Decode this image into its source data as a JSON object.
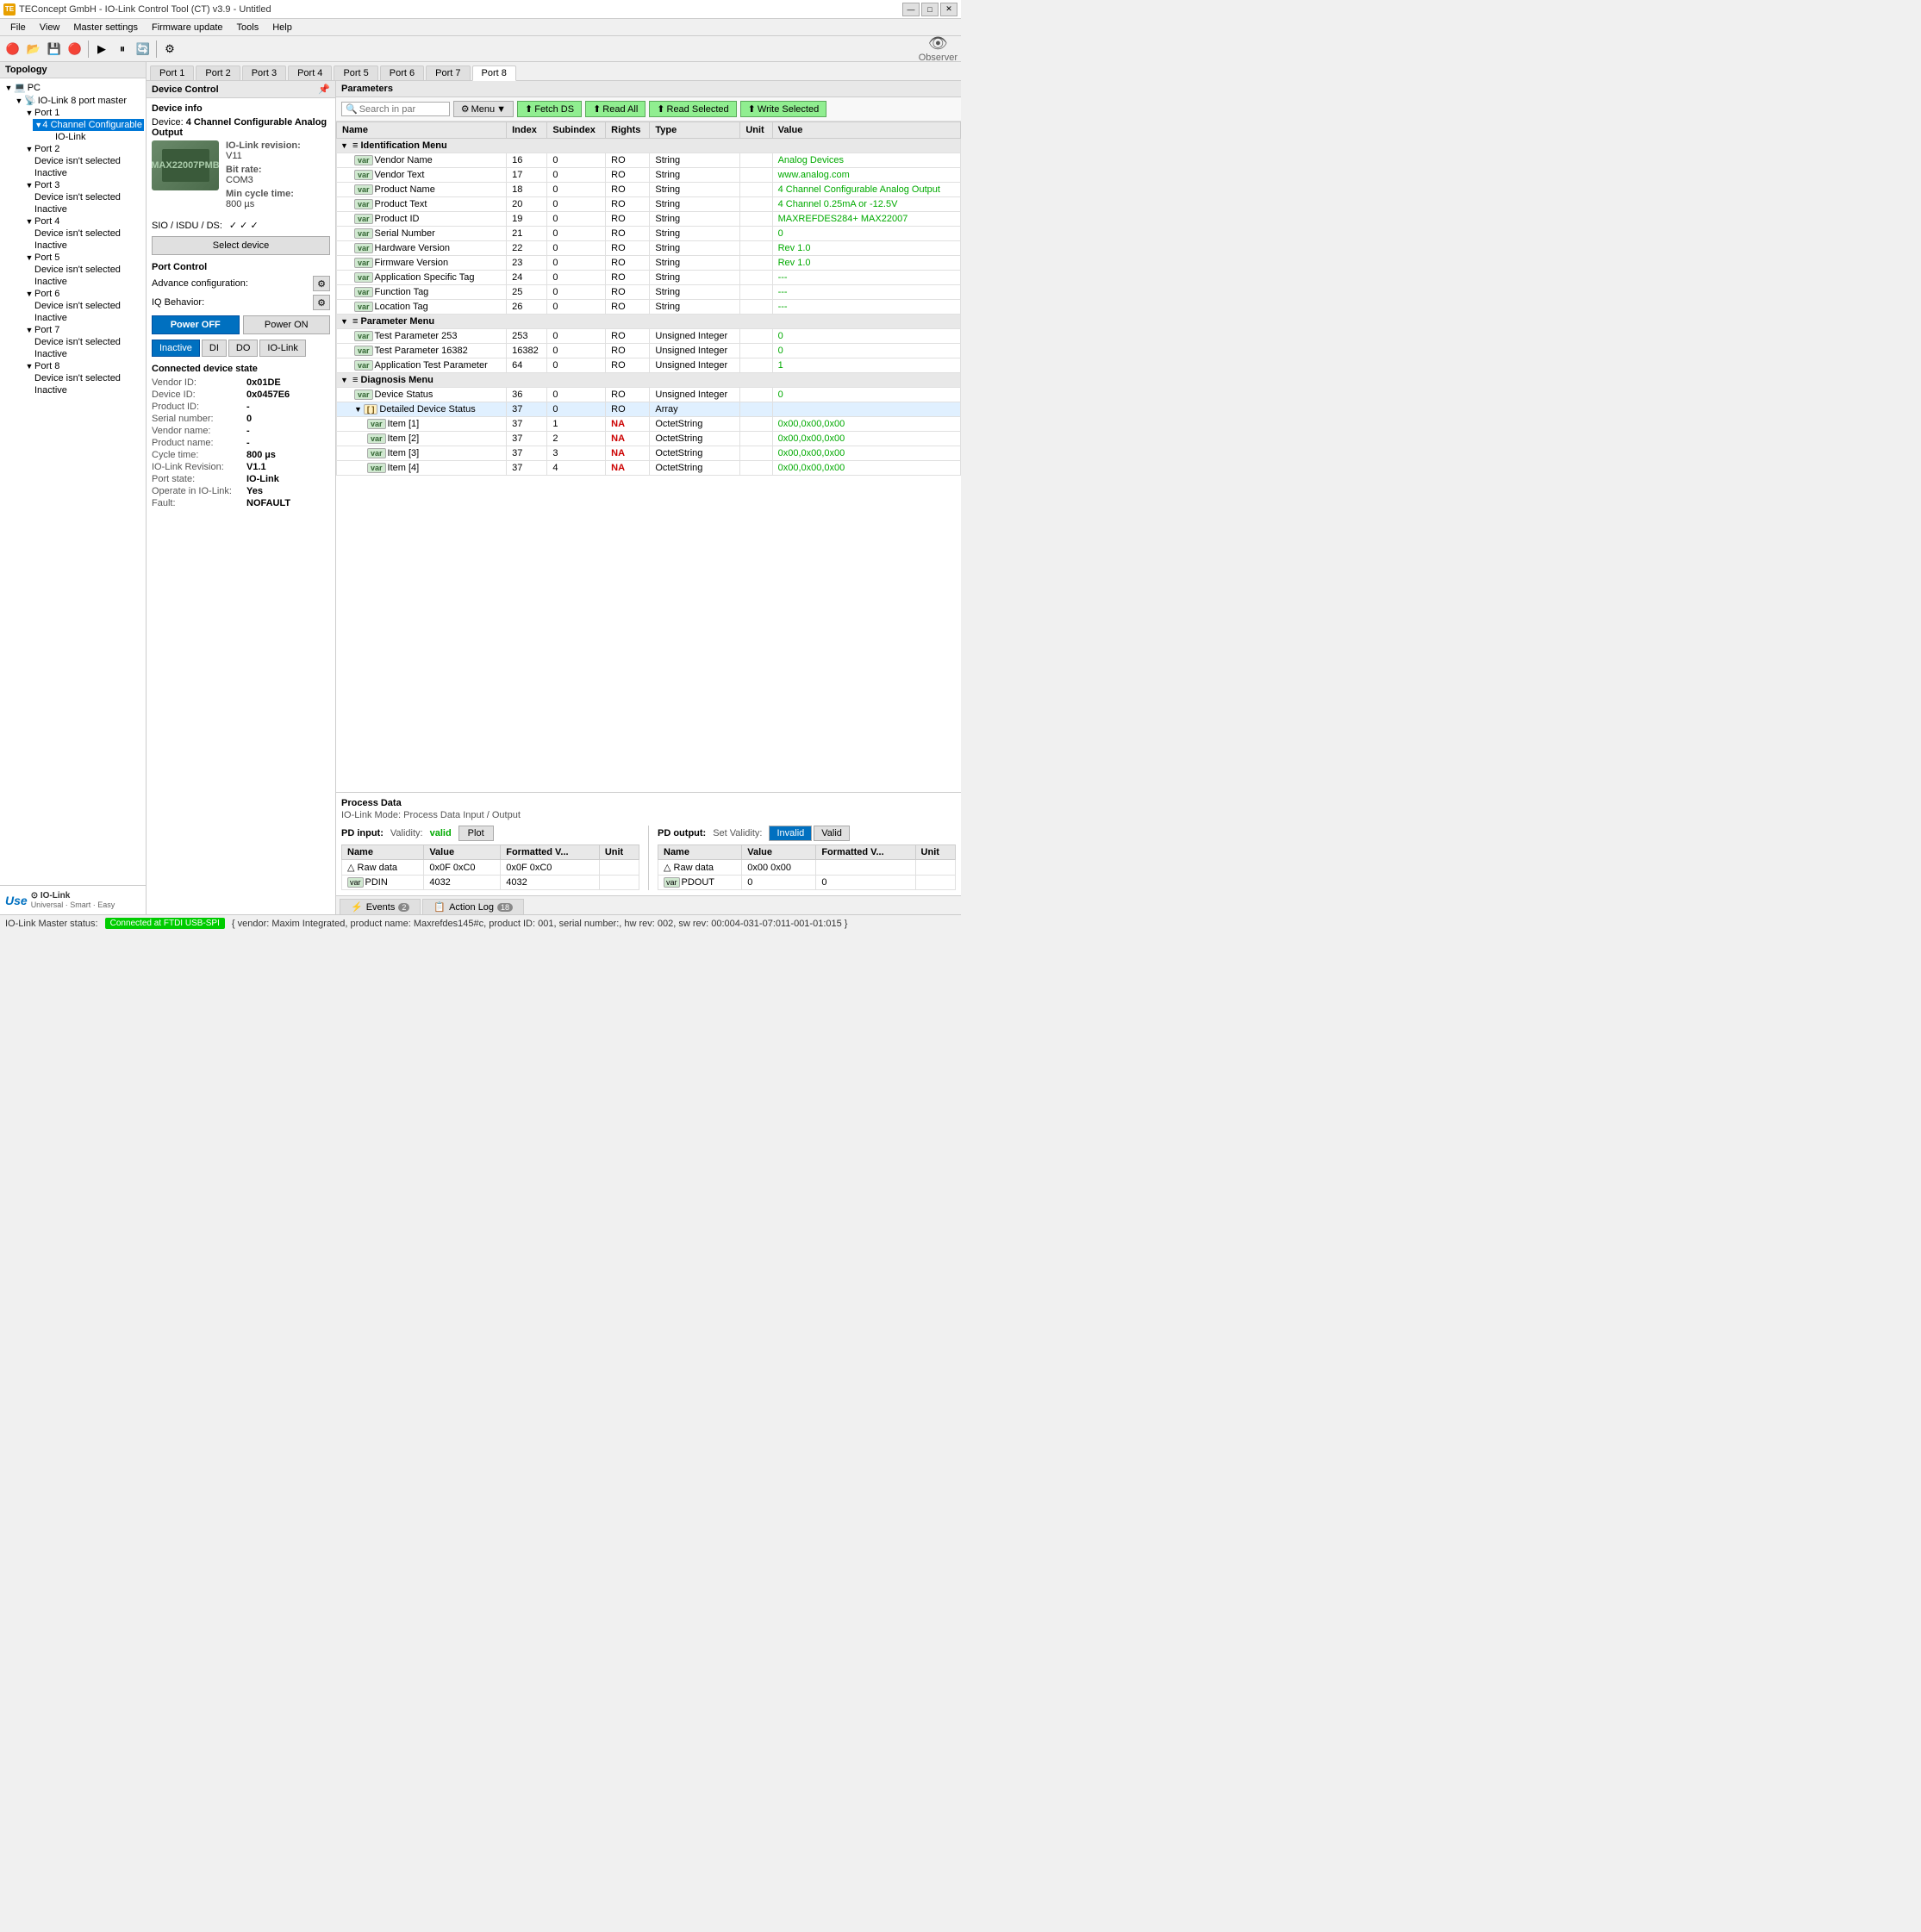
{
  "window": {
    "title": "TEConcept GmbH - IO-Link Control Tool (CT) v3.9 - Untitled",
    "icon": "TE"
  },
  "titlebar": {
    "controls": [
      "—",
      "□",
      "✕"
    ]
  },
  "menubar": {
    "items": [
      "File",
      "View",
      "Master settings",
      "Firmware update",
      "Tools",
      "Help"
    ]
  },
  "toolbar": {
    "observer_label": "Observer"
  },
  "topology": {
    "header": "Topology",
    "tree": {
      "pc": "PC",
      "master": "IO-Link 8 port master",
      "port1": "Port 1",
      "device1": "4 Channel Configurable",
      "iolink1": "IO-Link",
      "port2": "Port 2",
      "device2": "Device isn't selected",
      "inactive2": "Inactive",
      "port3": "Port 3",
      "device3": "Device isn't selected",
      "inactive3": "Inactive",
      "port4": "Port 4",
      "device4": "Device isn't selected",
      "inactive4": "Inactive",
      "port5": "Port 5",
      "device5": "Device isn't selected",
      "inactive5": "Inactive",
      "port6": "Port 6",
      "device6": "Device isn't selected",
      "inactive6": "Inactive",
      "port7": "Port 7",
      "device7": "Device isn't selected",
      "inactive7": "Inactive",
      "port8": "Port 8",
      "device8": "Device isn't selected",
      "inactive8": "Inactive"
    },
    "logo": {
      "use": "Use",
      "iolink": "⊙ IO-Link",
      "tagline": "Universal · Smart · Easy"
    }
  },
  "port_tabs": [
    "Port 1",
    "Port 2",
    "Port 3",
    "Port 4",
    "Port 5",
    "Port 6",
    "Port 7",
    "Port 8"
  ],
  "active_port": "Port 8",
  "device_control": {
    "header": "Device Control",
    "device_info_label": "Device info",
    "device_label": "Device:",
    "device_name": "4 Channel Configurable Analog Output",
    "device_image_label": "Device Image",
    "chip_label": "MAX22007PMB",
    "revision_label": "IO-Link revision:",
    "revision_val": "V11",
    "bitrate_label": "Bit rate:",
    "bitrate_val": "COM3",
    "min_cycle_label": "Min cycle time:",
    "min_cycle_val": "800 µs",
    "sio_label": "SIO / ISDU / DS:",
    "sio_checks": "✓  ✓  ✓",
    "select_device_btn": "Select device",
    "port_control_label": "Port Control",
    "adv_config_label": "Advance configuration:",
    "iq_behavior_label": "IQ Behavior:",
    "power_off_btn": "Power OFF",
    "power_on_btn": "Power ON",
    "state_tabs": [
      "Inactive",
      "DI",
      "DO",
      "IO-Link"
    ],
    "active_state_tab": "Inactive",
    "conn_state_label": "Connected device state",
    "conn_rows": [
      {
        "label": "Vendor ID:",
        "val": "0x01DE"
      },
      {
        "label": "Device ID:",
        "val": "0x0457E6"
      },
      {
        "label": "Product ID:",
        "val": "-"
      },
      {
        "label": "Serial number:",
        "val": "0"
      },
      {
        "label": "Vendor name:",
        "val": "-"
      },
      {
        "label": "Product name:",
        "val": "-"
      },
      {
        "label": "Cycle time:",
        "val": "800 µs"
      },
      {
        "label": "IO-Link Revision:",
        "val": "V1.1"
      },
      {
        "label": "Port state:",
        "val": "IO-Link"
      },
      {
        "label": "Operate in IO-Link:",
        "val": "Yes"
      },
      {
        "label": "Fault:",
        "val": "NOFAULT"
      }
    ]
  },
  "parameters": {
    "header": "Parameters",
    "search_placeholder": "Search in par",
    "toolbar_btns": {
      "menu": "Menu",
      "fetch_ds": "Fetch DS",
      "read_all": "Read All",
      "read_selected": "Read Selected",
      "write_selected": "Write Selected"
    },
    "table_headers": [
      "Name",
      "Index",
      "Subindex",
      "Rights",
      "Type",
      "Unit",
      "Value"
    ],
    "sections": [
      {
        "name": "Identification Menu",
        "rows": [
          {
            "badge": "var",
            "name": "Vendor Name",
            "index": "16",
            "subindex": "0",
            "rights": "RO",
            "type": "String",
            "unit": "",
            "value": "Analog Devices"
          },
          {
            "badge": "var",
            "name": "Vendor Text",
            "index": "17",
            "subindex": "0",
            "rights": "RO",
            "type": "String",
            "unit": "",
            "value": "www.analog.com"
          },
          {
            "badge": "var",
            "name": "Product Name",
            "index": "18",
            "subindex": "0",
            "rights": "RO",
            "type": "String",
            "unit": "",
            "value": "4 Channel Configurable Analog Output"
          },
          {
            "badge": "var",
            "name": "Product Text",
            "index": "20",
            "subindex": "0",
            "rights": "RO",
            "type": "String",
            "unit": "",
            "value": "4 Channel 0.25mA or -12.5V"
          },
          {
            "badge": "var",
            "name": "Product ID",
            "index": "19",
            "subindex": "0",
            "rights": "RO",
            "type": "String",
            "unit": "",
            "value": "MAXREFDES284+ MAX22007"
          },
          {
            "badge": "var",
            "name": "Serial Number",
            "index": "21",
            "subindex": "0",
            "rights": "RO",
            "type": "String",
            "unit": "",
            "value": "0"
          },
          {
            "badge": "var",
            "name": "Hardware Version",
            "index": "22",
            "subindex": "0",
            "rights": "RO",
            "type": "String",
            "unit": "",
            "value": "Rev 1.0"
          },
          {
            "badge": "var",
            "name": "Firmware Version",
            "index": "23",
            "subindex": "0",
            "rights": "RO",
            "type": "String",
            "unit": "",
            "value": "Rev 1.0"
          },
          {
            "badge": "var",
            "name": "Application Specific Tag",
            "index": "24",
            "subindex": "0",
            "rights": "RO",
            "type": "String",
            "unit": "",
            "value": "---"
          },
          {
            "badge": "var",
            "name": "Function Tag",
            "index": "25",
            "subindex": "0",
            "rights": "RO",
            "type": "String",
            "unit": "",
            "value": "---"
          },
          {
            "badge": "var",
            "name": "Location Tag",
            "index": "26",
            "subindex": "0",
            "rights": "RO",
            "type": "String",
            "unit": "",
            "value": "---"
          }
        ]
      },
      {
        "name": "Parameter Menu",
        "rows": [
          {
            "badge": "var",
            "name": "Test Parameter 253",
            "index": "253",
            "subindex": "0",
            "rights": "RO",
            "type": "Unsigned Integer",
            "unit": "",
            "value": "0"
          },
          {
            "badge": "var",
            "name": "Test Parameter 16382",
            "index": "16382",
            "subindex": "0",
            "rights": "RO",
            "type": "Unsigned Integer",
            "unit": "",
            "value": "0"
          },
          {
            "badge": "var",
            "name": "Application Test Parameter",
            "index": "64",
            "subindex": "0",
            "rights": "RO",
            "type": "Unsigned Integer",
            "unit": "",
            "value": "1"
          }
        ]
      },
      {
        "name": "Diagnosis Menu",
        "rows": [
          {
            "badge": "var",
            "name": "Device Status",
            "index": "36",
            "subindex": "0",
            "rights": "RO",
            "type": "Unsigned Integer",
            "unit": "",
            "value": "0"
          },
          {
            "badge": "arr",
            "name": "Detailed Device Status",
            "index": "37",
            "subindex": "0",
            "rights": "RO",
            "type": "Array",
            "unit": "",
            "value": "",
            "expanded": true,
            "children": [
              {
                "badge": "var",
                "name": "Item [1]",
                "index": "37",
                "subindex": "1",
                "rights": "NA",
                "type": "OctetString",
                "unit": "",
                "value": "0x00,0x00,0x00"
              },
              {
                "badge": "var",
                "name": "Item [2]",
                "index": "37",
                "subindex": "2",
                "rights": "NA",
                "type": "OctetString",
                "unit": "",
                "value": "0x00,0x00,0x00"
              },
              {
                "badge": "var",
                "name": "Item [3]",
                "index": "37",
                "subindex": "3",
                "rights": "NA",
                "type": "OctetString",
                "unit": "",
                "value": "0x00,0x00,0x00"
              },
              {
                "badge": "var",
                "name": "Item [4]",
                "index": "37",
                "subindex": "4",
                "rights": "NA",
                "type": "OctetString",
                "unit": "",
                "value": "0x00,0x00,0x00"
              }
            ]
          }
        ]
      }
    ]
  },
  "process_data": {
    "header": "Process Data",
    "mode": "IO-Link Mode: Process Data Input / Output",
    "input": {
      "label": "PD input:",
      "validity_label": "Validity:",
      "validity_val": "valid",
      "plot_btn": "Plot",
      "table_headers": [
        "Name",
        "Value",
        "Formatted V...",
        "Unit"
      ],
      "rows": [
        {
          "name": "△ Raw data",
          "value": "0x0F 0xC0",
          "formatted": "0x0F 0xC0",
          "unit": ""
        },
        {
          "badge": "var",
          "name": "PDIN",
          "value": "4032",
          "formatted": "4032",
          "unit": ""
        }
      ]
    },
    "output": {
      "label": "PD output:",
      "set_validity_label": "Set Validity:",
      "invalid_btn": "Invalid",
      "valid_btn": "Valid",
      "table_headers": [
        "Name",
        "Value",
        "Formatted V...",
        "Unit"
      ],
      "rows": [
        {
          "name": "△ Raw data",
          "value": "0x00 0x00",
          "formatted": "",
          "unit": ""
        },
        {
          "badge": "var",
          "name": "PDOUT",
          "value": "0",
          "formatted": "0",
          "unit": ""
        }
      ]
    }
  },
  "bottom_tabs": [
    {
      "label": "Events",
      "badge": "2"
    },
    {
      "label": "Action Log",
      "badge": "18"
    }
  ],
  "statusbar": {
    "label": "IO-Link Master status:",
    "connected": "Connected at FTDI USB-SPI",
    "detail": "{ vendor: Maxim Integrated, product name: Maxrefdes145#c, product ID: 001, serial number:, hw rev: 002, sw rev: 00:004-031-07:011-001-01:015 }"
  }
}
